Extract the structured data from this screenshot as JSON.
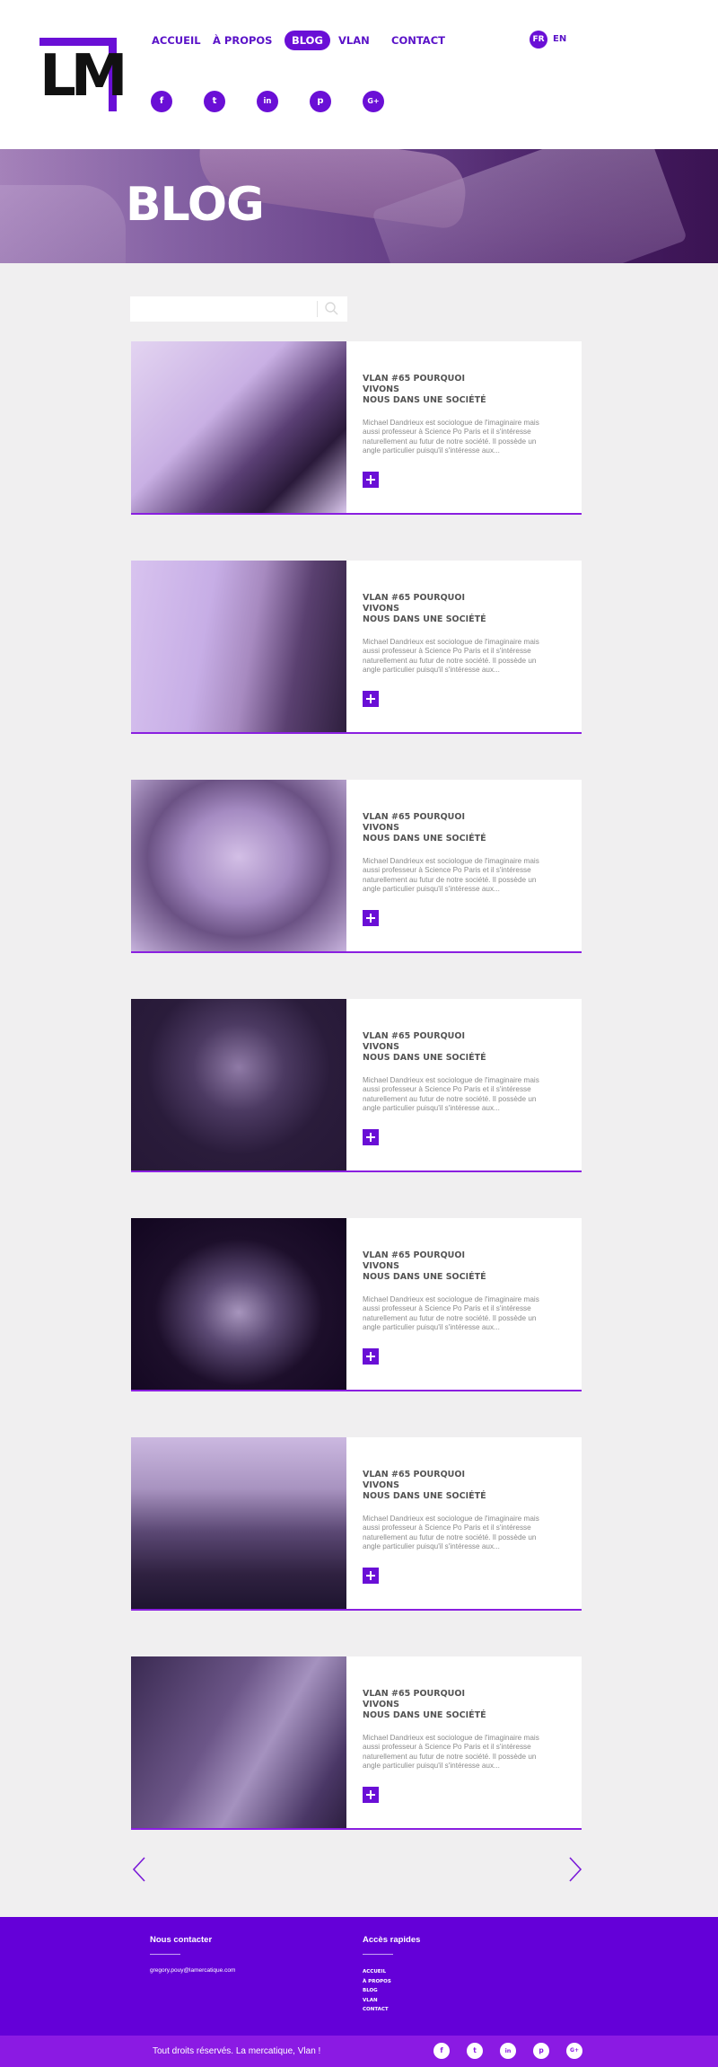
{
  "header": {
    "logo_text": "LM",
    "nav": [
      {
        "label": "ACCUEIL"
      },
      {
        "label": "À PROPOS"
      },
      {
        "label": "BLOG",
        "active": true
      },
      {
        "label": "VLAN"
      },
      {
        "label": "CONTACT"
      }
    ],
    "lang": {
      "fr": "FR",
      "en": "EN"
    },
    "social": [
      {
        "icon": "facebook-icon",
        "glyph": "f"
      },
      {
        "icon": "twitter-icon",
        "glyph": "t"
      },
      {
        "icon": "linkedin-icon",
        "glyph": "in"
      },
      {
        "icon": "pinterest-icon",
        "glyph": "p"
      },
      {
        "icon": "googleplus-icon",
        "glyph": "G+"
      }
    ]
  },
  "hero": {
    "title": "BLOG"
  },
  "search": {
    "placeholder": ""
  },
  "posts": [
    {
      "title_line1": "VLAN #65 POURQUOI",
      "title_line2": "VIVONS",
      "title_line3": "NOUS DANS UNE SOCIÉTÉ",
      "excerpt": "Michael Dandrieux est sociologue de l'imaginaire mais aussi professeur à Science Po Paris et il s'intéresse naturellement au futur de notre société. Il possède un angle particulier puisqu'il s'intéresse aux...",
      "photo": "man-with-headphones"
    },
    {
      "title_line1": "VLAN #65 POURQUOI",
      "title_line2": "VIVONS",
      "title_line3": "NOUS DANS UNE SOCIÉTÉ",
      "excerpt": "Michael Dandrieux est sociologue de l'imaginaire mais aussi professeur à Science Po Paris et il s'intéresse naturellement au futur de notre société. Il possède un angle particulier puisqu'il s'intéresse aux...",
      "photo": "woman-with-glasses"
    },
    {
      "title_line1": "VLAN #65 POURQUOI",
      "title_line2": "VIVONS",
      "title_line3": "NOUS DANS UNE SOCIÉTÉ",
      "excerpt": "Michael Dandrieux est sociologue de l'imaginaire mais aussi professeur à Science Po Paris et il s'intéresse naturellement au futur de notre société. Il possède un angle particulier puisqu'il s'intéresse aux...",
      "photo": "young-man-portrait"
    },
    {
      "title_line1": "VLAN #65 POURQUOI",
      "title_line2": "VIVONS",
      "title_line3": "NOUS DANS UNE SOCIÉTÉ",
      "excerpt": "Michael Dandrieux est sociologue de l'imaginaire mais aussi professeur à Science Po Paris et il s'intéresse naturellement au futur de notre société. Il possède un angle particulier puisqu'il s'intéresse aux...",
      "photo": "woman-portrait-dark"
    },
    {
      "title_line1": "VLAN #65 POURQUOI",
      "title_line2": "VIVONS",
      "title_line3": "NOUS DANS UNE SOCIÉTÉ",
      "excerpt": "Michael Dandrieux est sociologue de l'imaginaire mais aussi professeur à Science Po Paris et il s'intéresse naturellement au futur de notre société. Il possède un angle particulier puisqu'il s'intéresse aux...",
      "photo": "bearded-man-glasses"
    },
    {
      "title_line1": "VLAN #65 POURQUOI",
      "title_line2": "VIVONS",
      "title_line3": "NOUS DANS UNE SOCIÉTÉ",
      "excerpt": "Michael Dandrieux est sociologue de l'imaginaire mais aussi professeur à Science Po Paris et il s'intéresse naturellement au futur de notre société. Il possède un angle particulier puisqu'il s'intéresse aux...",
      "photo": "man-in-studio"
    },
    {
      "title_line1": "VLAN #65 POURQUOI",
      "title_line2": "VIVONS",
      "title_line3": "NOUS DANS UNE SOCIÉTÉ",
      "excerpt": "Michael Dandrieux est sociologue de l'imaginaire mais aussi professeur à Science Po Paris et il s'intéresse naturellement au futur de notre société. Il possède un angle particulier puisqu'il s'intéresse aux...",
      "photo": "woman-profile"
    }
  ],
  "footer": {
    "contact_heading": "Nous contacter",
    "email": "gregory.pouy@lamercatique.com",
    "quick_heading": "Accès rapides",
    "links": [
      "ACCUEIL",
      "À PROPOS",
      "BLOG",
      "VLAN",
      "CONTACT"
    ],
    "copyright": "Tout droits réservés. La mercatique, Vlan !",
    "social": [
      {
        "icon": "facebook-icon",
        "glyph": "f"
      },
      {
        "icon": "twitter-icon",
        "glyph": "t"
      },
      {
        "icon": "linkedin-icon",
        "glyph": "in"
      },
      {
        "icon": "pinterest-icon",
        "glyph": "p"
      },
      {
        "icon": "googleplus-icon",
        "glyph": "G+"
      }
    ]
  },
  "colors": {
    "accent": "#6a0fd6",
    "footer": "#6400d8",
    "bottom_bar": "#8b1ae3",
    "background": "#f0eff0"
  }
}
